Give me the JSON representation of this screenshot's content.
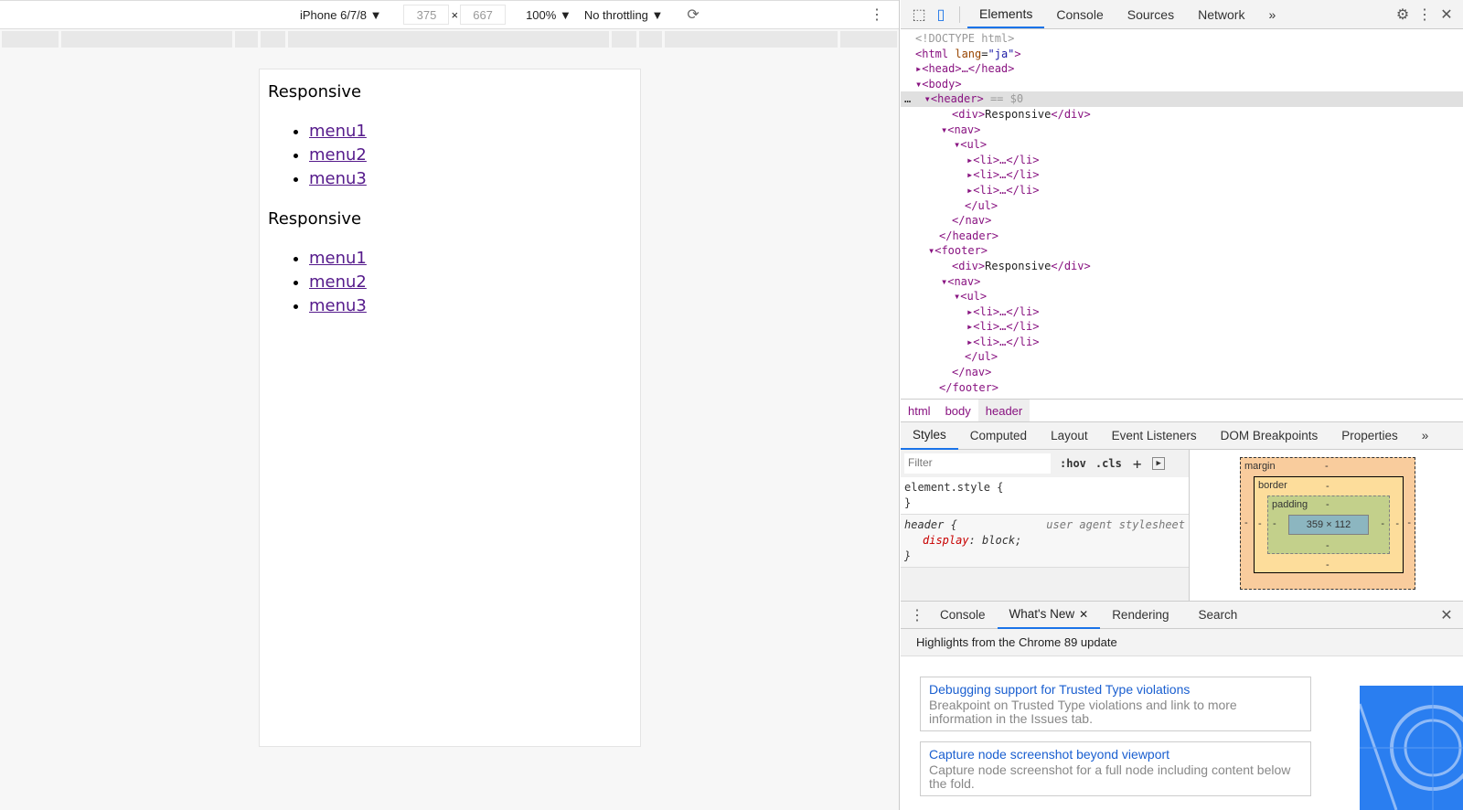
{
  "toolbar": {
    "device": "iPhone 6/7/8 ▼",
    "width": "375",
    "times": "×",
    "height": "667",
    "zoom": "100% ▼",
    "throttling": "No throttling ▼"
  },
  "page": {
    "sections": [
      {
        "title": "Responsive",
        "menu": [
          "menu1",
          "menu2",
          "menu3"
        ]
      },
      {
        "title": "Responsive",
        "menu": [
          "menu1",
          "menu2",
          "menu3"
        ]
      }
    ]
  },
  "devtools": {
    "tabs": [
      "Elements",
      "Console",
      "Sources",
      "Network",
      "»"
    ],
    "dom": {
      "doctype": "<!DOCTYPE html>",
      "html_open": "<html ",
      "lang_attr": "lang",
      "lang_val": "\"ja\"",
      "head": "<head>…</head>",
      "body": "<body>",
      "header": "<header>",
      "selected_marker": " == $0",
      "div": "<div>",
      "div_text": "Responsive",
      "div_close": "</div>",
      "nav": "<nav>",
      "ul": "<ul>",
      "li": "<li>…</li>",
      "ul_close": "</ul>",
      "nav_close": "</nav>",
      "header_close": "</header>",
      "footer": "<footer>",
      "footer_close": "</footer>"
    },
    "breadcrumbs": [
      "html",
      "body",
      "header"
    ],
    "style_tabs": [
      "Styles",
      "Computed",
      "Layout",
      "Event Listeners",
      "DOM Breakpoints",
      "Properties",
      "»"
    ],
    "filter_placeholder": "Filter",
    "hov": ":hov",
    "cls": ".cls",
    "rules": {
      "element_style": "element.style {",
      "close": "}",
      "header_sel": "header {",
      "origin": "user agent stylesheet",
      "prop": "display",
      "val": "block;"
    },
    "box_model": {
      "margin": "margin",
      "border": "border",
      "padding": "padding",
      "content": "359 × 112",
      "dash": "-"
    },
    "drawer_tabs": [
      "Console",
      "What's New",
      "Rendering",
      "Search"
    ],
    "highlights": "Highlights from the Chrome 89 update",
    "cards": [
      {
        "title": "Debugging support for Trusted Type violations",
        "desc": "Breakpoint on Trusted Type violations and link to more information in the Issues tab."
      },
      {
        "title": "Capture node screenshot beyond viewport",
        "desc": "Capture node screenshot for a full node including content below the fold."
      }
    ]
  }
}
